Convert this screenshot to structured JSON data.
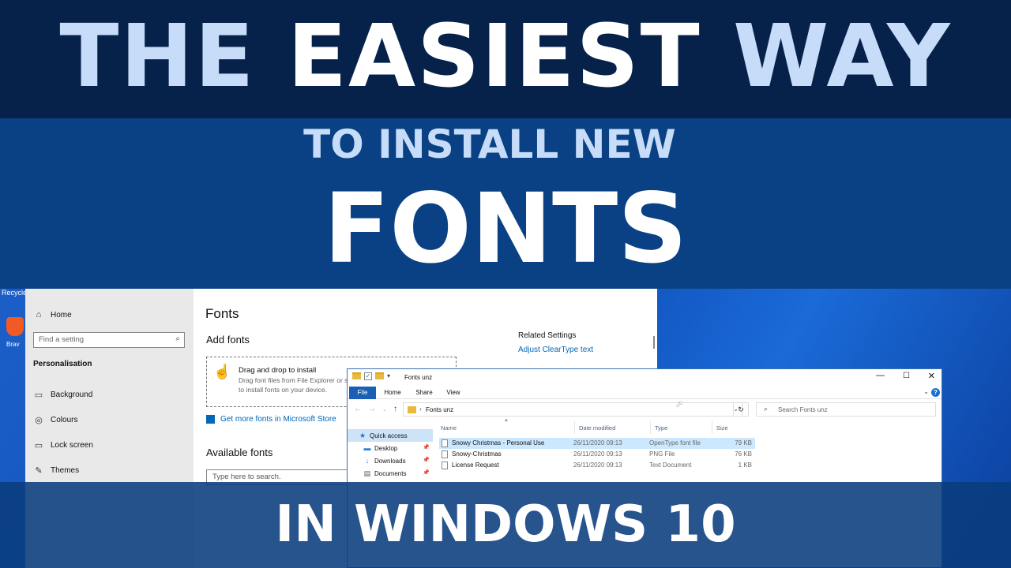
{
  "title": {
    "line1": [
      "THE",
      "EASIEST",
      "WAY"
    ],
    "line2": "TO INSTALL NEW",
    "line3": "FONTS",
    "line4": "IN WINDOWS 10"
  },
  "desktop": {
    "icons": [
      {
        "label": "Recycle",
        "icon": "recycle-bin-icon"
      },
      {
        "label": "Brav",
        "icon": "brave-browser-icon"
      }
    ]
  },
  "settings": {
    "nav": {
      "home": "Home",
      "search_placeholder": "Find a setting",
      "section": "Personalisation",
      "items": [
        {
          "label": "Background",
          "icon": "picture-icon"
        },
        {
          "label": "Colours",
          "icon": "palette-icon"
        },
        {
          "label": "Lock screen",
          "icon": "monitor-icon"
        },
        {
          "label": "Themes",
          "icon": "brush-icon"
        }
      ]
    },
    "main": {
      "title": "Fonts",
      "add_heading": "Add fonts",
      "drop_title": "Drag and drop to install",
      "drop_desc": "Drag font files from File Explorer or s to install fonts on your device.",
      "store_link": "Get more fonts in Microsoft Store",
      "available_heading": "Available fonts",
      "search_placeholder": "Type here to search.",
      "related_heading": "Related Settings",
      "related_links": [
        "Adjust ClearType text"
      ]
    }
  },
  "explorer": {
    "title": "Fonts unz",
    "ribbon_tabs": [
      "File",
      "Home",
      "Share",
      "View"
    ],
    "address": "Fonts unz",
    "search_placeholder": "Search Fonts unz",
    "nav_pane": [
      {
        "label": "Quick access",
        "icon": "star-icon",
        "pinned": false
      },
      {
        "label": "Desktop",
        "icon": "desktop-icon",
        "pinned": true
      },
      {
        "label": "Downloads",
        "icon": "download-icon",
        "pinned": true
      },
      {
        "label": "Documents",
        "icon": "document-icon",
        "pinned": true
      }
    ],
    "columns": [
      "Name",
      "Date modified",
      "Type",
      "Size"
    ],
    "files": [
      {
        "name": "Snowy Christmas - Personal Use",
        "date": "26/11/2020 09:13",
        "type": "OpenType font file",
        "size": "79 KB",
        "selected": true
      },
      {
        "name": "Snowy-Christmas",
        "date": "26/11/2020 09:13",
        "type": "PNG File",
        "size": "76 KB",
        "selected": false
      },
      {
        "name": "License Request",
        "date": "26/11/2020 09:13",
        "type": "Text Document",
        "size": "1 KB",
        "selected": false
      }
    ]
  },
  "colors": {
    "top_banner": "#06224a",
    "mid_banner": "#0a4184",
    "title_light": "#c6dcf8",
    "link_blue": "#0067b8"
  }
}
